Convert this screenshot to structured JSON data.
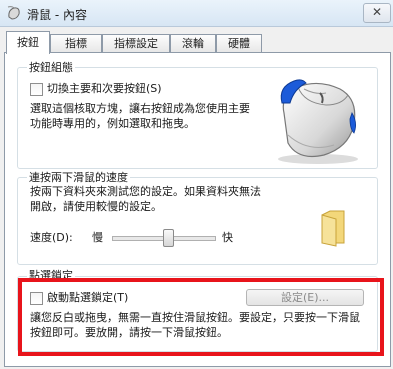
{
  "window": {
    "title": "滑鼠 - 內容",
    "close_glyph": "✕"
  },
  "tabs": [
    {
      "label": "按鈕",
      "active": true
    },
    {
      "label": "指標"
    },
    {
      "label": "指標設定"
    },
    {
      "label": "滾輪"
    },
    {
      "label": "硬體"
    }
  ],
  "button_config": {
    "label": "按鈕組態",
    "checkbox_label": "切換主要和次要按鈕(S)",
    "checked": false,
    "description": "選取這個核取方塊，讓右按鈕成為您使用主要功能時專用的，例如選取和拖曳。"
  },
  "double_click": {
    "label": "連按兩下滑鼠的速度",
    "description": "按兩下資料夾來測試您的設定。如果資料夾無法開啟，請使用較慢的設定。",
    "speed_label": "速度(D):",
    "slow_label": "慢",
    "fast_label": "快",
    "speed_level": 0.55
  },
  "click_lock": {
    "label": "點選鎖定",
    "checkbox_label": "啟動點選鎖定(T)",
    "checked": false,
    "settings_button": "設定(E)...",
    "description": "讓您反白或拖曳，無需一直按住滑鼠按鈕。要設定，只要按一下滑鼠按鈕即可。要放開，請按一下滑鼠按鈕。"
  },
  "colors": {
    "highlight": "#e8141b",
    "accent": "#1c5bd9"
  }
}
